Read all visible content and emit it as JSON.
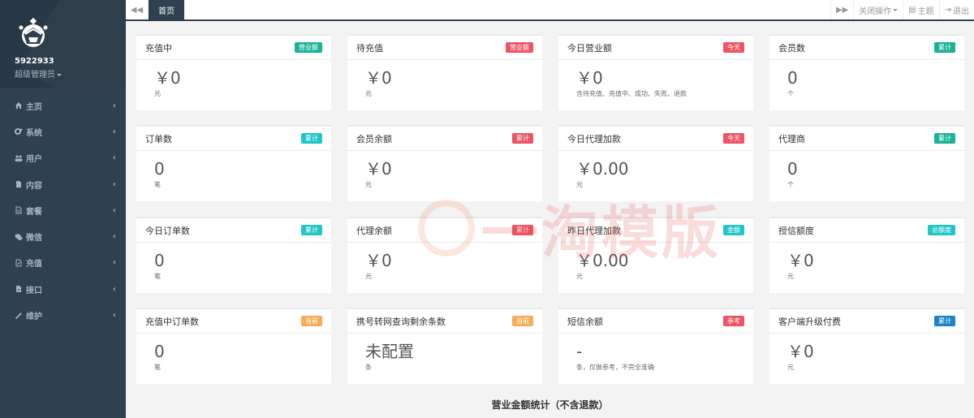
{
  "sidebar": {
    "user_name": "5922933",
    "user_role": "超级管理员",
    "items": [
      {
        "label": "主页",
        "icon": "home-icon"
      },
      {
        "label": "系统",
        "icon": "cogs-icon"
      },
      {
        "label": "用户",
        "icon": "users-icon"
      },
      {
        "label": "内容",
        "icon": "file-icon"
      },
      {
        "label": "套餐",
        "icon": "file-text-icon"
      },
      {
        "label": "微信",
        "icon": "wechat-icon"
      },
      {
        "label": "充值",
        "icon": "file-edit-icon"
      },
      {
        "label": "接口",
        "icon": "file-alt-icon"
      },
      {
        "label": "维护",
        "icon": "magic-icon"
      }
    ]
  },
  "topbar": {
    "home_tab": "首页",
    "close_ops": "关闭操作",
    "theme": "主题",
    "logout": "退出"
  },
  "cards": [
    {
      "title": "充值中",
      "badge": "营业额",
      "badge_color": "#1ab394",
      "value": "￥0",
      "unit": "元"
    },
    {
      "title": "待充值",
      "badge": "营业额",
      "badge_color": "#ed5565",
      "value": "￥0",
      "unit": "元"
    },
    {
      "title": "今日营业额",
      "badge": "今天",
      "badge_color": "#ed5565",
      "value": "￥0",
      "unit": "含待充值、充值中、成功、失败、退款"
    },
    {
      "title": "会员数",
      "badge": "累计",
      "badge_color": "#1ab394",
      "value": "0",
      "unit": "个"
    },
    {
      "title": "订单数",
      "badge": "累计",
      "badge_color": "#23c6c8",
      "value": "0",
      "unit": "笔"
    },
    {
      "title": "会员余额",
      "badge": "累计",
      "badge_color": "#ed5565",
      "value": "￥0",
      "unit": "元"
    },
    {
      "title": "今日代理加款",
      "badge": "今天",
      "badge_color": "#ed5565",
      "value": "￥0.00",
      "unit": "元"
    },
    {
      "title": "代理商",
      "badge": "累计",
      "badge_color": "#1ab394",
      "value": "0",
      "unit": "个"
    },
    {
      "title": "今日订单数",
      "badge": "累计",
      "badge_color": "#23c6c8",
      "value": "0",
      "unit": "笔"
    },
    {
      "title": "代理余额",
      "badge": "累计",
      "badge_color": "#ed5565",
      "value": "￥0",
      "unit": "元"
    },
    {
      "title": "昨日代理加款",
      "badge": "金额",
      "badge_color": "#23c6c8",
      "value": "￥0.00",
      "unit": "元"
    },
    {
      "title": "授信额度",
      "badge": "总额度",
      "badge_color": "#23c6c8",
      "value": "￥0",
      "unit": "元"
    },
    {
      "title": "充值中订单数",
      "badge": "当前",
      "badge_color": "#f8ac59",
      "value": "0",
      "unit": "笔"
    },
    {
      "title": "携号转网查询剩余条数",
      "badge": "当前",
      "badge_color": "#f8ac59",
      "value": "未配置",
      "unit": "条"
    },
    {
      "title": "短信余额",
      "badge": "参考",
      "badge_color": "#ed5565",
      "value": "-",
      "unit": "条，仅做参考，不完全准确"
    },
    {
      "title": "客户端升级付费",
      "badge": "累计",
      "badge_color": "#1c84c6",
      "value": "￥0",
      "unit": "元"
    }
  ],
  "section_title": "营业金额统计（不含退款）",
  "watermark_text": "一淘模版"
}
